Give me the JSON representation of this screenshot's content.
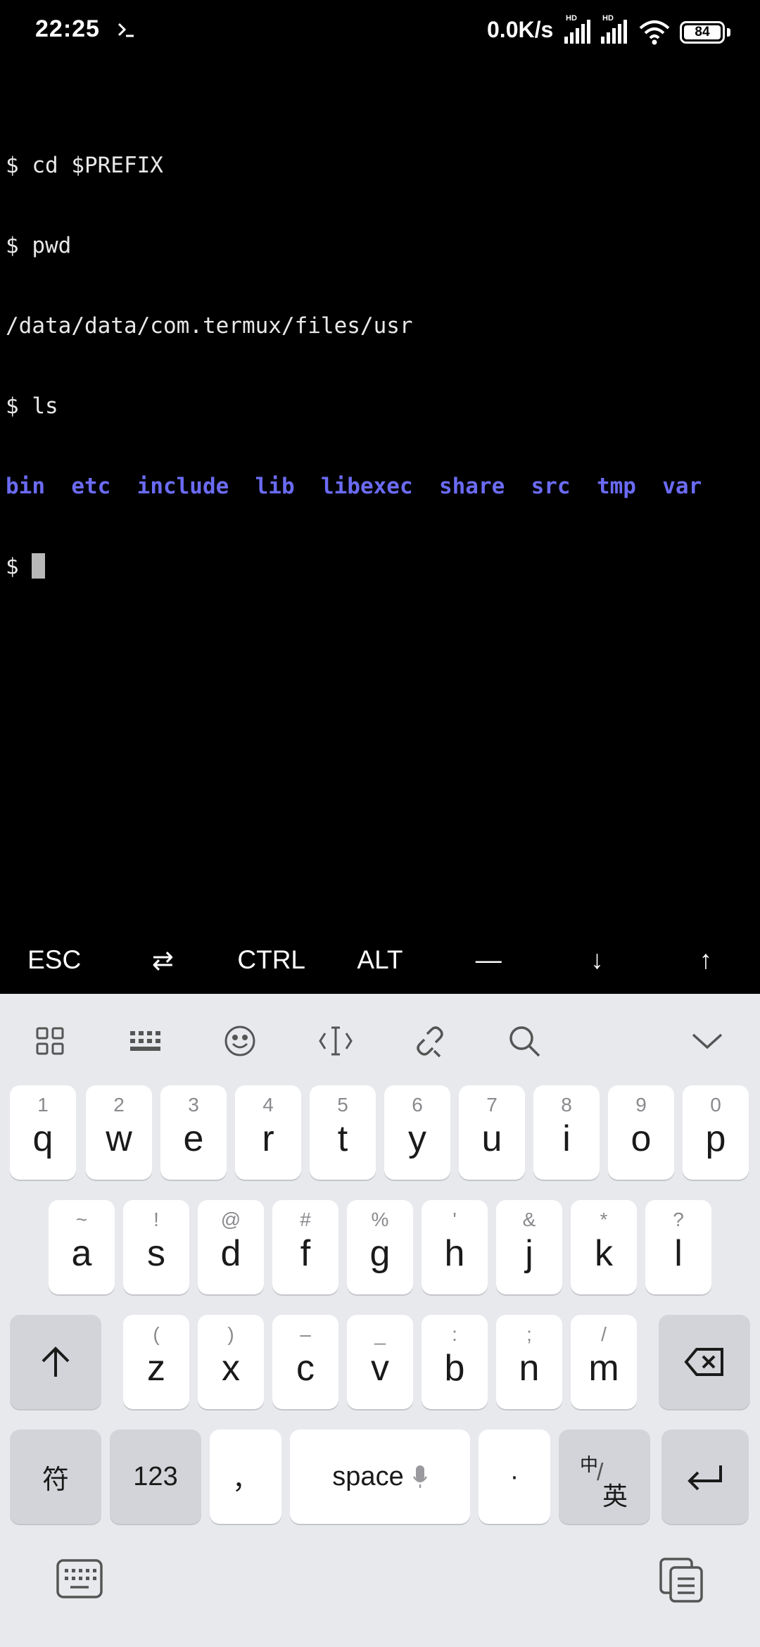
{
  "status_bar": {
    "time": "22:25",
    "net_speed": "0.0K/s",
    "hd_label": "HD",
    "battery": "84"
  },
  "terminal": {
    "lines": [
      "$ cd $PREFIX",
      "$ pwd",
      "/data/data/com.termux/files/usr",
      "$ ls"
    ],
    "ls_items": [
      "bin",
      "etc",
      "include",
      "lib",
      "libexec",
      "share",
      "src",
      "tmp",
      "var"
    ],
    "prompt": "$ "
  },
  "extra_keys": [
    "ESC",
    "⇄",
    "CTRL",
    "ALT",
    "—",
    "↓",
    "↑"
  ],
  "keyboard": {
    "toolbar_icons": [
      "grid-icon",
      "keyboard-layout-icon",
      "emoji-icon",
      "cursor-icon",
      "clip-icon",
      "search-icon",
      "collapse-icon"
    ],
    "row1": [
      {
        "key": "q",
        "hint": "1"
      },
      {
        "key": "w",
        "hint": "2"
      },
      {
        "key": "e",
        "hint": "3"
      },
      {
        "key": "r",
        "hint": "4"
      },
      {
        "key": "t",
        "hint": "5"
      },
      {
        "key": "y",
        "hint": "6"
      },
      {
        "key": "u",
        "hint": "7"
      },
      {
        "key": "i",
        "hint": "8"
      },
      {
        "key": "o",
        "hint": "9"
      },
      {
        "key": "p",
        "hint": "0"
      }
    ],
    "row2": [
      {
        "key": "a",
        "hint": "~"
      },
      {
        "key": "s",
        "hint": "!"
      },
      {
        "key": "d",
        "hint": "@"
      },
      {
        "key": "f",
        "hint": "#"
      },
      {
        "key": "g",
        "hint": "%"
      },
      {
        "key": "h",
        "hint": "'"
      },
      {
        "key": "j",
        "hint": "&"
      },
      {
        "key": "k",
        "hint": "*"
      },
      {
        "key": "l",
        "hint": "?"
      }
    ],
    "row3": [
      {
        "key": "z",
        "hint": "("
      },
      {
        "key": "x",
        "hint": ")"
      },
      {
        "key": "c",
        "hint": "–"
      },
      {
        "key": "v",
        "hint": "_"
      },
      {
        "key": "b",
        "hint": ":"
      },
      {
        "key": "n",
        "hint": ";"
      },
      {
        "key": "m",
        "hint": "/"
      }
    ],
    "symbol_key": "符",
    "num_key": "123",
    "comma_key": "，",
    "space_key": "space",
    "period_key": "·",
    "lang_key_top": "中",
    "lang_key_bottom": "英"
  }
}
